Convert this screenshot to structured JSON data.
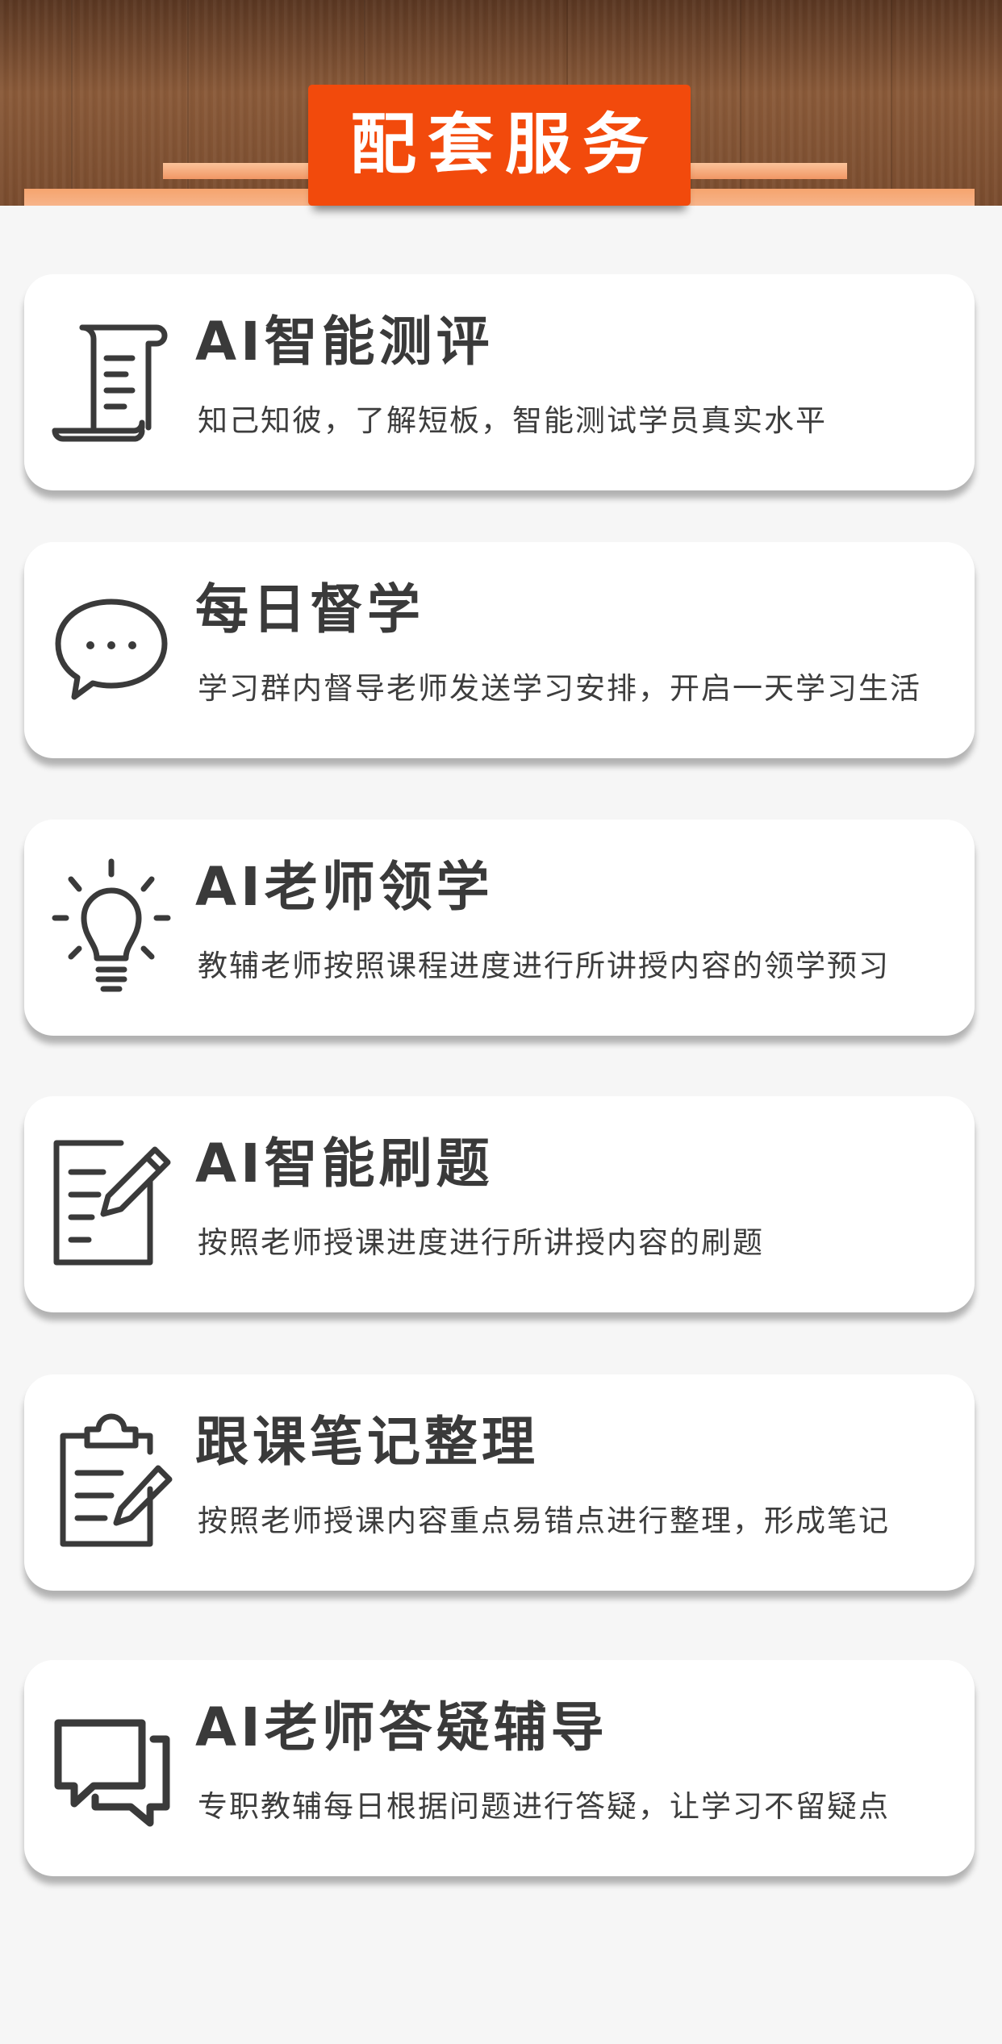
{
  "header": {
    "title": "配套服务"
  },
  "services": [
    {
      "icon": "scroll-document-icon",
      "title": "AI智能测评",
      "desc": "知己知彼，了解短板，智能测试学员真实水平"
    },
    {
      "icon": "chat-bubble-icon",
      "title": "每日督学",
      "desc": "学习群内督导老师发送学习安排，开启一天学习生活"
    },
    {
      "icon": "lightbulb-icon",
      "title": "AI老师领学",
      "desc": "教辅老师按照课程进度进行所讲授内容的领学预习"
    },
    {
      "icon": "document-pencil-icon",
      "title": "AI智能刷题",
      "desc": "按照老师授课进度进行所讲授内容的刷题"
    },
    {
      "icon": "clipboard-pencil-icon",
      "title": "跟课笔记整理",
      "desc": "按照老师授课内容重点易错点进行整理，形成笔记"
    },
    {
      "icon": "double-speech-bubble-icon",
      "title": "AI老师答疑辅导",
      "desc": "专职教辅每日根据问题进行答疑，让学习不留疑点"
    }
  ]
}
